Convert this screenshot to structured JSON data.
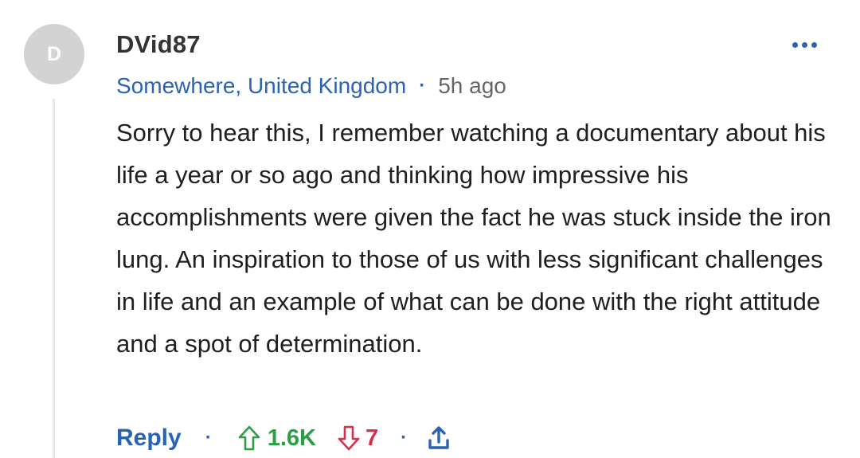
{
  "comment": {
    "avatar_initial": "D",
    "username": "DVid87",
    "location": "Somewhere, United Kingdom",
    "separator": "·",
    "time_ago": "5h ago",
    "text": "Sorry to hear this, I remember watching a documentary about his life a year or so ago and thinking how impressive his accomplishments were given the fact he was stuck inside the iron lung. An inspiration to those of us with less significant challenges in life and an example of what can be done with the right attitude and a spot of determination.",
    "actions": {
      "reply_label": "Reply",
      "upvotes": "1.6K",
      "downvotes": "7"
    }
  },
  "icons": {
    "more": "more-options-icon",
    "upvote": "arrow-up-icon",
    "downvote": "arrow-down-icon",
    "share": "share-icon"
  },
  "colors": {
    "link_blue": "#2a62b4",
    "upvote_green": "#2c9e45",
    "downvote_red": "#d6304b",
    "avatar_gray": "#d3d3d3"
  }
}
